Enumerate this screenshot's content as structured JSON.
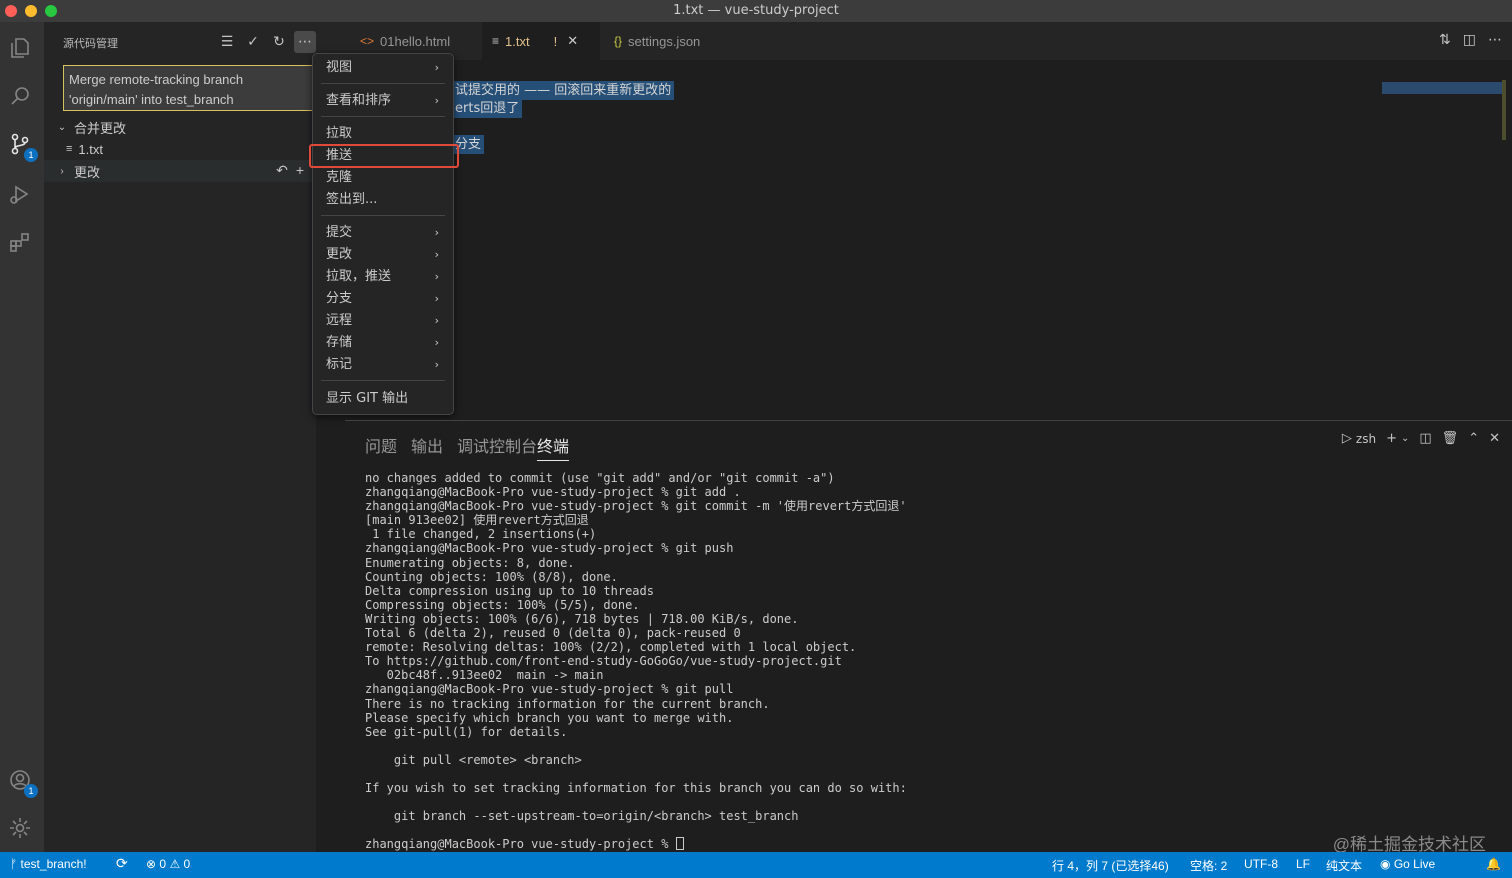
{
  "window": {
    "title": "1.txt — vue-study-project"
  },
  "activity_bar": {
    "scm_badge": "1",
    "account_badge": "1"
  },
  "sidebar": {
    "title": "源代码管理",
    "commit_message": "Merge remote-tracking branch 'origin/main' into test_branch",
    "merge_group_label": "合并更改",
    "merge_file": "1.txt",
    "changes_group_label": "更改"
  },
  "tabs": [
    {
      "label": "01hello.html",
      "icon": "html-icon"
    },
    {
      "label": "1.txt",
      "icon": "text-file-icon",
      "modified": "!"
    },
    {
      "label": "settings.json",
      "icon": "json-icon"
    }
  ],
  "editor": {
    "line1": "试提交用的 —— 回滚回来重新更改的",
    "line2": "erts回退了",
    "line3": "分支"
  },
  "menu": {
    "items": [
      {
        "label": "视图",
        "sub": "›"
      },
      {
        "label": "查看和排序",
        "sub": "›"
      },
      {
        "label": "拉取"
      },
      {
        "label": "推送",
        "highlighted": true
      },
      {
        "label": "克隆"
      },
      {
        "label": "签出到..."
      },
      {
        "label": "提交",
        "sub": "›"
      },
      {
        "label": "更改",
        "sub": "›"
      },
      {
        "label": "拉取，推送",
        "sub": "›"
      },
      {
        "label": "分支",
        "sub": "›"
      },
      {
        "label": "远程",
        "sub": "›"
      },
      {
        "label": "存储",
        "sub": "›"
      },
      {
        "label": "标记",
        "sub": "›"
      },
      {
        "label": "显示 GIT 输出"
      }
    ]
  },
  "panel": {
    "tabs": [
      "问题",
      "输出",
      "调试控制台",
      "终端"
    ],
    "active_tab": "终端",
    "shell": "zsh",
    "terminal_lines": [
      "no changes added to commit (use \"git add\" and/or \"git commit -a\")",
      "zhangqiang@MacBook-Pro vue-study-project % git add .",
      "zhangqiang@MacBook-Pro vue-study-project % git commit -m '使用revert方式回退'",
      "[main 913ee02] 使用revert方式回退",
      " 1 file changed, 2 insertions(+)",
      "zhangqiang@MacBook-Pro vue-study-project % git push",
      "Enumerating objects: 8, done.",
      "Counting objects: 100% (8/8), done.",
      "Delta compression using up to 10 threads",
      "Compressing objects: 100% (5/5), done.",
      "Writing objects: 100% (6/6), 718 bytes | 718.00 KiB/s, done.",
      "Total 6 (delta 2), reused 0 (delta 0), pack-reused 0",
      "remote: Resolving deltas: 100% (2/2), completed with 1 local object.",
      "To https://github.com/front-end-study-GoGoGo/vue-study-project.git",
      "   02bc48f..913ee02  main -> main",
      "zhangqiang@MacBook-Pro vue-study-project % git pull",
      "There is no tracking information for the current branch.",
      "Please specify which branch you want to merge with.",
      "See git-pull(1) for details.",
      "",
      "    git pull <remote> <branch>",
      "",
      "If you wish to set tracking information for this branch you can do so with:",
      "",
      "    git branch --set-upstream-to=origin/<branch> test_branch",
      "",
      "zhangqiang@MacBook-Pro vue-study-project % "
    ]
  },
  "status_bar": {
    "branch": "test_branch!",
    "errors": "0",
    "warnings": "0",
    "position": "行 4，列 7 (已选择46)",
    "spaces": "空格: 2",
    "encoding": "UTF-8",
    "eol": "LF",
    "language": "纯文本",
    "go_live": "Go Live"
  },
  "watermark": "@稀土掘金技术社区",
  "colors": {
    "status_bar": "#007acc",
    "highlight_border": "#e04b39",
    "selection": "#264f78"
  }
}
